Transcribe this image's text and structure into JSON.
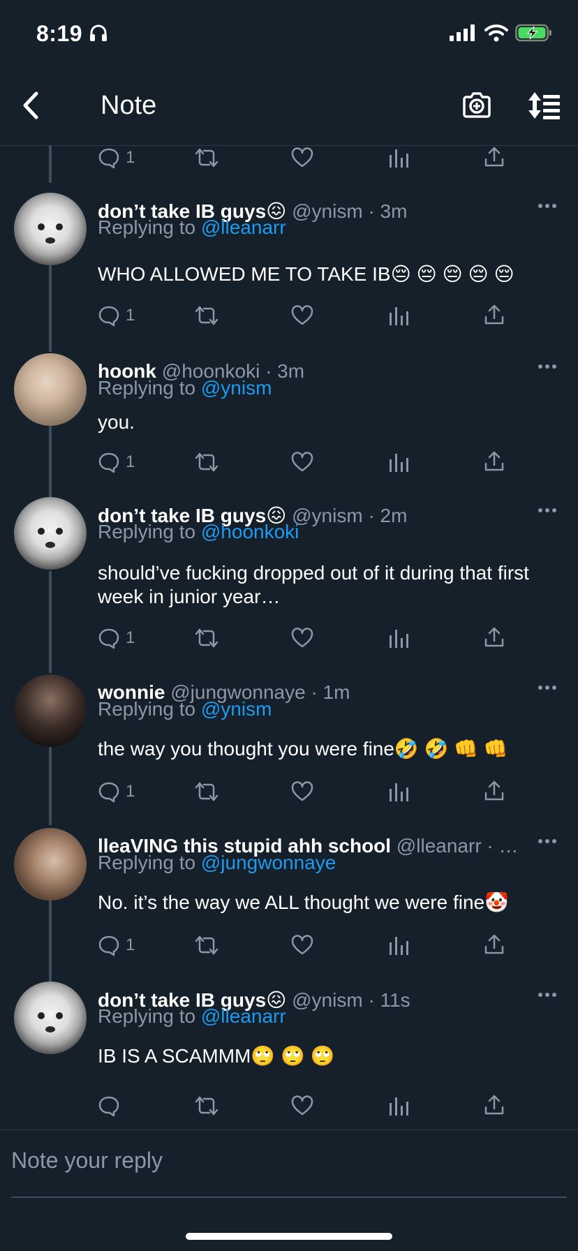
{
  "status_bar": {
    "time": "8:19"
  },
  "header": {
    "title": "Note"
  },
  "reply_bar": {
    "placeholder": "Note your reply"
  },
  "tweets": [
    {
      "name": "don’t take IB guys😖",
      "handle": "@ynism · 3m",
      "replying_prefix": "Replying to ",
      "replying_to": "@lleanarr",
      "text": "WHO ALLOWED ME TO TAKE IB😔 😔 😔 😔 😔",
      "reply_count": "1"
    },
    {
      "name": "hoonk",
      "handle": "@hoonkoki · 3m",
      "replying_prefix": "Replying to ",
      "replying_to": "@ynism",
      "text": "you.",
      "reply_count": "1"
    },
    {
      "name": "don’t take IB guys😖",
      "handle": "@ynism · 2m",
      "replying_prefix": "Replying to ",
      "replying_to": "@hoonkoki",
      "text": "should’ve fucking dropped out of it during that first week in junior year…",
      "reply_count": "1"
    },
    {
      "name": "wonnie",
      "handle": "@jungwonnaye · 1m",
      "replying_prefix": "Replying to ",
      "replying_to": "@ynism",
      "text": "the way you thought you were fine🤣 🤣 👊 👊",
      "reply_count": "1"
    },
    {
      "name": "lleaVING this stupid ahh school",
      "handle": "@lleanarr · …",
      "replying_prefix": "Replying to ",
      "replying_to": "@jungwonnaye",
      "text": "No. it’s the way we ALL thought we were fine🤡",
      "reply_count": "1"
    },
    {
      "name": "don’t take IB guys😖",
      "handle": "@ynism · 11s",
      "replying_prefix": "Replying to ",
      "replying_to": "@lleanarr",
      "text": "IB IS A SCAMMM🙄 🙄 🙄",
      "reply_count": ""
    }
  ],
  "top_actions": {
    "reply_count": "1"
  },
  "icons": {
    "back": "chevron-left-icon",
    "camera": "camera-plus-icon",
    "sort": "sort-icon",
    "reply": "comment-icon",
    "retweet": "retweet-icon",
    "like": "heart-icon",
    "views": "bar-chart-icon",
    "share": "share-icon"
  },
  "colors": {
    "background": "#15202b",
    "mention": "#1d9bf0",
    "muted": "#8b98a5"
  }
}
